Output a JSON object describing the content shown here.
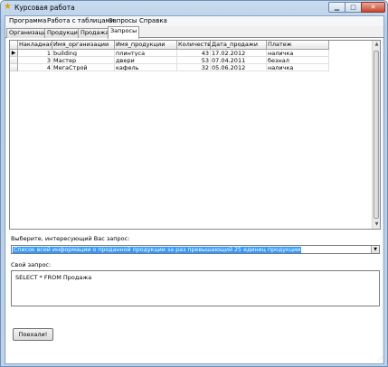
{
  "window": {
    "title": "Курсовая работа"
  },
  "menu": [
    "Программа",
    "Работа с таблицами",
    "Запросы",
    "Справка"
  ],
  "tabs": [
    "Организации",
    "Продукция",
    "Продажа",
    "Запросы"
  ],
  "active_tab": 3,
  "grid": {
    "columns": [
      "Накладная",
      "Имя_организации",
      "Имя_продукции",
      "Количество",
      "Дата_продажи",
      "Платеж"
    ],
    "rows": [
      [
        "1",
        "building",
        "плинтуса",
        "43",
        "17.02.2012",
        "наличка"
      ],
      [
        "3",
        "Мастер",
        "двери",
        "53",
        "07.04.2011",
        "безнал"
      ],
      [
        "4",
        "МегаСтрой",
        "кафель",
        "32",
        "05.06.2012",
        "наличка"
      ]
    ],
    "current_row": 0
  },
  "query": {
    "select_label": "Выберите, интересующий Вас запрос:",
    "selected": "Список всей информации о проданной продукции за раз превышающий 25 единиц продукции",
    "custom_label": "Свой запрос:",
    "custom_text": "SELECT * FROM Продажа",
    "run_label": "Поехали!"
  },
  "icons": {
    "app": "star-icon",
    "minimize": "minimize-icon",
    "maximize": "maximize-icon",
    "close": "close-icon",
    "dropdown": "chevron-down-icon",
    "row_pointer": "row-pointer-icon"
  }
}
